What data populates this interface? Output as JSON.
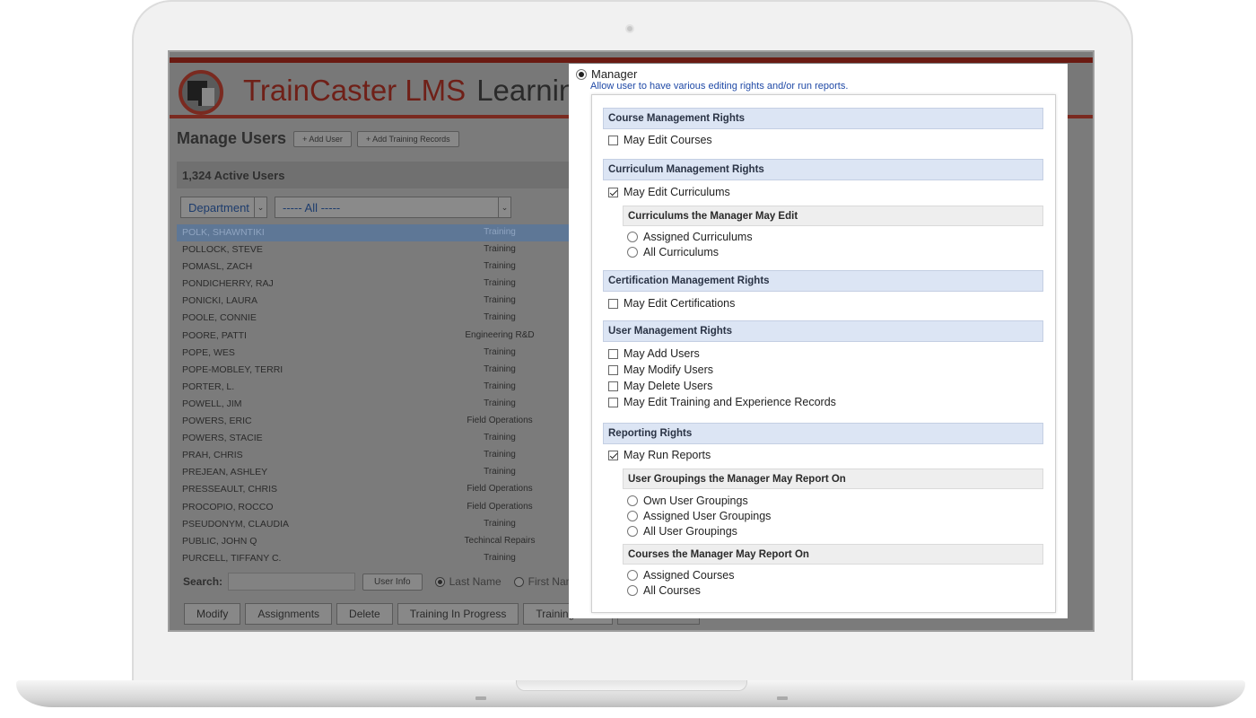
{
  "app": {
    "title": "TrainCaster LMS",
    "title_suffix": "Learnin",
    "page_title": "Manage Users",
    "add_user_button": "+ Add User",
    "add_training_records_button": "+ Add Training Records",
    "active_users": "1,324 Active Users",
    "filter": {
      "field_label": "Department",
      "value_label": "----- All -----"
    },
    "users": [
      {
        "name": "POLK, SHAWNTIKI",
        "dept": "Training"
      },
      {
        "name": "POLLOCK, STEVE",
        "dept": "Training"
      },
      {
        "name": "POMASL, ZACH",
        "dept": "Training"
      },
      {
        "name": "PONDICHERRY, RAJ",
        "dept": "Training"
      },
      {
        "name": "PONICKI, LAURA",
        "dept": "Training"
      },
      {
        "name": "POOLE, CONNIE",
        "dept": "Training"
      },
      {
        "name": "POORE, PATTI",
        "dept": "Engineering R&D"
      },
      {
        "name": "POPE, WES",
        "dept": "Training"
      },
      {
        "name": "POPE-MOBLEY, TERRI",
        "dept": "Training"
      },
      {
        "name": "PORTER, L.",
        "dept": "Training"
      },
      {
        "name": "POWELL, JIM",
        "dept": "Training"
      },
      {
        "name": "POWERS, ERIC",
        "dept": "Field Operations"
      },
      {
        "name": "POWERS, STACIE",
        "dept": "Training"
      },
      {
        "name": "PRAH, CHRIS",
        "dept": "Training"
      },
      {
        "name": "PREJEAN, ASHLEY",
        "dept": "Training"
      },
      {
        "name": "PRESSEAULT, CHRIS",
        "dept": "Field Operations"
      },
      {
        "name": "PROCOPIO, ROCCO",
        "dept": "Field Operations"
      },
      {
        "name": "PSEUDONYM, CLAUDIA",
        "dept": "Training"
      },
      {
        "name": "PUBLIC, JOHN Q",
        "dept": "Techincal Repairs"
      },
      {
        "name": "PURCELL, TIFFANY C.",
        "dept": "Training"
      }
    ],
    "search_label": "Search:",
    "user_info_button": "User Info",
    "search_by": {
      "last_name": "Last Name",
      "first_name": "First Nam"
    },
    "bottom_buttons": {
      "modify": "Modify",
      "assignments": "Assignments",
      "delete": "Delete",
      "training_in_progress": "Training In Progress",
      "training_completed": "Training Com"
    }
  },
  "modal": {
    "role": "Manager",
    "role_description": "Allow user to have various editing rights and/or run reports.",
    "course_mgmt": {
      "title": "Course Management Rights",
      "may_edit_courses": "May Edit Courses"
    },
    "curriculum_mgmt": {
      "title": "Curriculum Management Rights",
      "may_edit_curriculums": "May Edit Curriculums",
      "sub_title": "Curriculums the Manager May Edit",
      "assigned": "Assigned Curriculums",
      "all": "All Curriculums"
    },
    "cert_mgmt": {
      "title": "Certification Management Rights",
      "may_edit_certs": "May Edit Certifications"
    },
    "user_mgmt": {
      "title": "User Management Rights",
      "may_add": "May Add Users",
      "may_modify": "May Modify Users",
      "may_delete": "May Delete Users",
      "may_edit_records": "May Edit Training and Experience Records"
    },
    "reporting": {
      "title": "Reporting Rights",
      "may_run": "May Run Reports",
      "groupings_title": "User Groupings the Manager May Report On",
      "own_groupings": "Own User Groupings",
      "assigned_groupings": "Assigned User Groupings",
      "all_groupings": "All User Groupings",
      "courses_title": "Courses the Manager May Report On",
      "assigned_courses": "Assigned Courses",
      "all_courses": "All Courses"
    }
  }
}
